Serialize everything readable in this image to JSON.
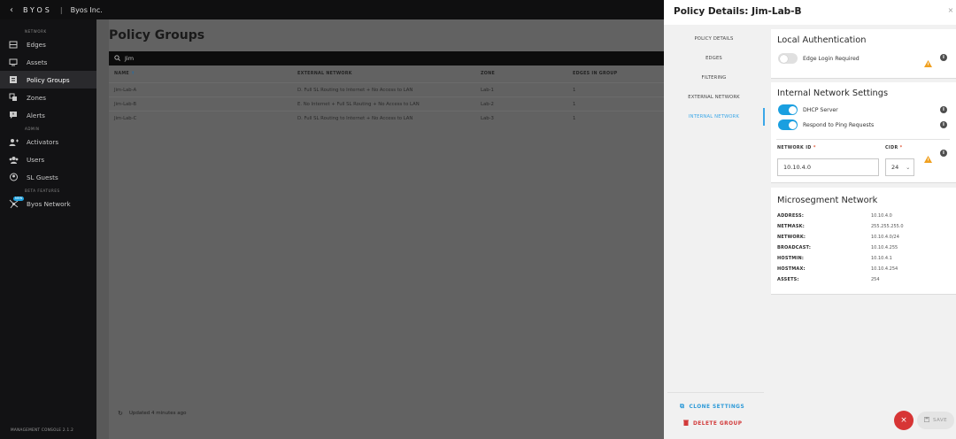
{
  "topbar": {
    "back_icon": "chevron-left-icon",
    "logo": "BYOS",
    "separator": "|",
    "company": "Byos Inc."
  },
  "sidebar": {
    "sections": [
      {
        "title": "NETWORK",
        "items": [
          {
            "label": "Edges",
            "icon": "edges-icon"
          },
          {
            "label": "Assets",
            "icon": "monitor-icon"
          },
          {
            "label": "Policy Groups",
            "icon": "policy-icon",
            "active": true
          },
          {
            "label": "Zones",
            "icon": "zones-icon"
          },
          {
            "label": "Alerts",
            "icon": "alert-icon"
          }
        ]
      },
      {
        "title": "ADMIN",
        "items": [
          {
            "label": "Activators",
            "icon": "activators-icon"
          },
          {
            "label": "Users",
            "icon": "users-icon"
          },
          {
            "label": "SL Guests",
            "icon": "guests-icon"
          }
        ]
      },
      {
        "title": "BETA FEATURES",
        "items": [
          {
            "label": "Byos Network",
            "icon": "network-icon",
            "badge": "NEW"
          }
        ]
      }
    ],
    "footer": "MANAGEMENT CONSOLE 2.1.2"
  },
  "main": {
    "title": "Policy Groups",
    "search_value": "Jim",
    "table": {
      "headers": [
        "NAME",
        "EXTERNAL NETWORK",
        "ZONE",
        "EDGES IN GROUP"
      ],
      "sort_indicator": "↑",
      "rows": [
        [
          "Jim-Lab-A",
          "D. Full SL Routing to Internet + No Access to LAN",
          "Lab-1",
          "1"
        ],
        [
          "Jim-Lab-B",
          "E. No Internet + Full SL Routing + No Access to LAN",
          "Lab-2",
          "1"
        ],
        [
          "Jim-Lab-C",
          "D. Full SL Routing to Internet + No Access to LAN",
          "Lab-3",
          "1"
        ]
      ]
    },
    "updated": "Updated 4 minutes ago"
  },
  "panel": {
    "title": "Policy Details: Jim-Lab-B",
    "close": "×",
    "nav": [
      "POLICY DETAILS",
      "EDGES",
      "FILTERING",
      "EXTERNAL NETWORK",
      "INTERNAL NETWORK"
    ],
    "active_nav": "INTERNAL NETWORK",
    "clone_label": "CLONE SETTINGS",
    "delete_label": "DELETE GROUP",
    "local_auth": {
      "title": "Local Authentication",
      "edge_login_label": "Edge Login Required",
      "edge_login_on": false
    },
    "internal": {
      "title": "Internal Network Settings",
      "dhcp_label": "DHCP Server",
      "dhcp_on": true,
      "ping_label": "Respond to Ping Requests",
      "ping_on": true,
      "network_id_label": "NETWORK ID",
      "network_id_value": "10.10.4.0",
      "cidr_label": "CIDR",
      "cidr_value": "24",
      "required_mark": "*"
    },
    "microsegment": {
      "title": "Microsegment Network",
      "rows": [
        {
          "k": "ADDRESS:",
          "v": "10.10.4.0"
        },
        {
          "k": "NETMASK:",
          "v": "255.255.255.0"
        },
        {
          "k": "NETWORK:",
          "v": "10.10.4.0/24"
        },
        {
          "k": "BROADCAST:",
          "v": "10.10.4.255"
        },
        {
          "k": "HOSTMIN:",
          "v": "10.10.4.1"
        },
        {
          "k": "HOSTMAX:",
          "v": "10.10.4.254"
        },
        {
          "k": "ASSETS:",
          "v": "254"
        }
      ]
    },
    "save_label": "SAVE",
    "fab_close": "×"
  },
  "colors": {
    "accent": "#1a9fe0",
    "danger": "#d73535",
    "warning": "#f0a020"
  }
}
